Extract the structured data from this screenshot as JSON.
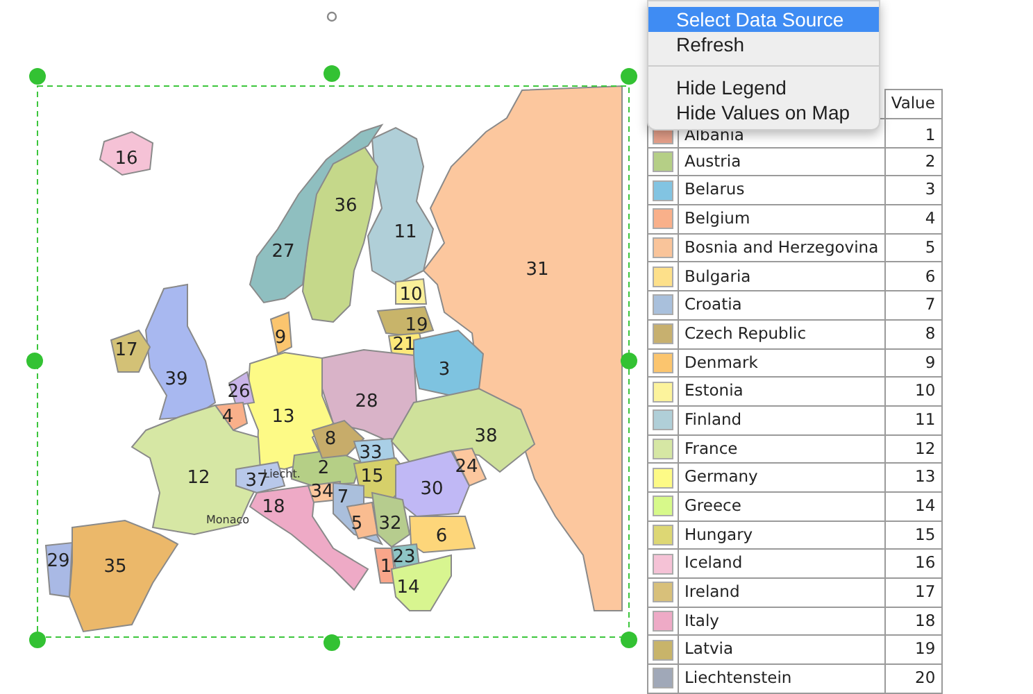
{
  "context_menu": {
    "items": [
      {
        "kind": "item",
        "label": "Select Data Source",
        "selected": true
      },
      {
        "kind": "item",
        "label": "Refresh",
        "selected": false
      },
      {
        "kind": "separator"
      },
      {
        "kind": "item",
        "label": "Hide Legend",
        "selected": false
      },
      {
        "kind": "item",
        "label": "Hide Values on Map",
        "selected": false
      }
    ]
  },
  "map": {
    "regions": [
      {
        "label": "31",
        "color": "#fcc79e"
      },
      {
        "label": "11",
        "color": "#b0cfd8"
      },
      {
        "label": "36",
        "color": "#c5d88a"
      },
      {
        "label": "27",
        "color": "#8fbfc0"
      },
      {
        "label": "16",
        "color": "#f5c2d6"
      },
      {
        "label": "39",
        "color": "#a8b8f0"
      },
      {
        "label": "17",
        "color": "#d3c176"
      },
      {
        "label": "9",
        "color": "#fbc56e"
      },
      {
        "label": "10",
        "color": "#faf09a"
      },
      {
        "label": "19",
        "color": "#c8b46a"
      },
      {
        "label": "21",
        "color": "#fde97a"
      },
      {
        "label": "3",
        "color": "#7ec3e0"
      },
      {
        "label": "28",
        "color": "#d9b3c8"
      },
      {
        "label": "13",
        "color": "#fdfa86"
      },
      {
        "label": "26",
        "color": "#c9b4e8"
      },
      {
        "label": "4",
        "color": "#f9b08a"
      },
      {
        "label": "12",
        "color": "#d6e7a4"
      },
      {
        "label": "29",
        "color": "#a9b9e5"
      },
      {
        "label": "35",
        "color": "#ebb86a"
      },
      {
        "label": "37",
        "color": "#b8c8ea"
      },
      {
        "label": "2",
        "color": "#b5cf86"
      },
      {
        "label": "8",
        "color": "#c7ac6a"
      },
      {
        "label": "33",
        "color": "#a9cfe6"
      },
      {
        "label": "15",
        "color": "#d6d06a"
      },
      {
        "label": "38",
        "color": "#cfe19b"
      },
      {
        "label": "24",
        "color": "#fcc79e"
      },
      {
        "label": "34",
        "color": "#fcc79e"
      },
      {
        "label": "30",
        "color": "#c0b8f5"
      },
      {
        "label": "7",
        "color": "#aabfdc"
      },
      {
        "label": "5",
        "color": "#f9bc90"
      },
      {
        "label": "32",
        "color": "#b6cc8e"
      },
      {
        "label": "6",
        "color": "#fdd67a"
      },
      {
        "label": "23",
        "color": "#8ec5c5"
      },
      {
        "label": "1",
        "color": "#f9a68a"
      },
      {
        "label": "14",
        "color": "#d8f590"
      },
      {
        "label": "18",
        "color": "#eeaac6"
      }
    ],
    "place_labels": [
      "Liecht.",
      "Monaco"
    ]
  },
  "legend": {
    "value_header": "Value",
    "rows": [
      {
        "name": "Albania",
        "value": "1",
        "color": "#e6a08a"
      },
      {
        "name": "Austria",
        "value": "2",
        "color": "#b5cf86"
      },
      {
        "name": "Belarus",
        "value": "3",
        "color": "#82c4e2"
      },
      {
        "name": "Belgium",
        "value": "4",
        "color": "#f9b08a"
      },
      {
        "name": "Bosnia and Herzegovina",
        "value": "5",
        "color": "#f9c49a"
      },
      {
        "name": "Bulgaria",
        "value": "6",
        "color": "#fde08a"
      },
      {
        "name": "Croatia",
        "value": "7",
        "color": "#a9c0dc"
      },
      {
        "name": "Czech Republic",
        "value": "8",
        "color": "#c7b06f"
      },
      {
        "name": "Denmark",
        "value": "9",
        "color": "#fbc56e"
      },
      {
        "name": "Estonia",
        "value": "10",
        "color": "#fcf39c"
      },
      {
        "name": "Finland",
        "value": "11",
        "color": "#b0cfd8"
      },
      {
        "name": "France",
        "value": "12",
        "color": "#d6e7a4"
      },
      {
        "name": "Germany",
        "value": "13",
        "color": "#fdfa86"
      },
      {
        "name": "Greece",
        "value": "14",
        "color": "#d7f98a"
      },
      {
        "name": "Hungary",
        "value": "15",
        "color": "#ddd774"
      },
      {
        "name": "Iceland",
        "value": "16",
        "color": "#f5c2d6"
      },
      {
        "name": "Ireland",
        "value": "17",
        "color": "#d8c07a"
      },
      {
        "name": "Italy",
        "value": "18",
        "color": "#eeaac6"
      },
      {
        "name": "Latvia",
        "value": "19",
        "color": "#c8b46a"
      },
      {
        "name": "Liechtenstein",
        "value": "20",
        "color": "#a0a8b8"
      }
    ]
  }
}
